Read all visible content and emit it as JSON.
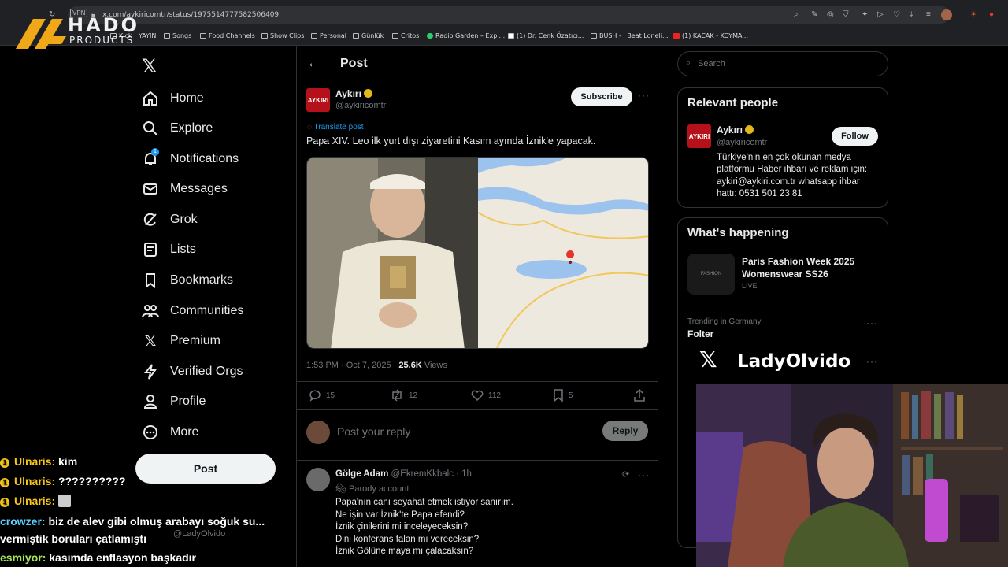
{
  "browser": {
    "url": "x.com/aykiricomtr/status/1975514777582506409",
    "vpn_badge": "VPN",
    "bookmarks": [
      "Kick",
      "YAYIN",
      "Songs",
      "Food Channels",
      "Show Clips",
      "Personal",
      "Günlük",
      "Critos",
      "Radio Garden – Expl...",
      "(1) Dr. Cenk Özatıcı...",
      "BUSH - I Beat Loneli...",
      "(1) KACAK - KOYMA..."
    ]
  },
  "overlay_logo": {
    "hado": "HADO",
    "products": "PRODUCTS"
  },
  "nav": {
    "items": [
      {
        "label": "Home",
        "icon": "home-icon"
      },
      {
        "label": "Explore",
        "icon": "search-icon"
      },
      {
        "label": "Notifications",
        "icon": "bell-icon"
      },
      {
        "label": "Messages",
        "icon": "mail-icon"
      },
      {
        "label": "Grok",
        "icon": "grok-icon"
      },
      {
        "label": "Lists",
        "icon": "list-icon"
      },
      {
        "label": "Bookmarks",
        "icon": "bookmark-icon"
      },
      {
        "label": "Communities",
        "icon": "communities-icon"
      },
      {
        "label": "Premium",
        "icon": "x-icon"
      },
      {
        "label": "Verified Orgs",
        "icon": "lightning-icon"
      },
      {
        "label": "Profile",
        "icon": "person-icon"
      },
      {
        "label": "More",
        "icon": "more-icon"
      }
    ],
    "notification_count": "1",
    "post_label": "Post",
    "profile_handle": "@LadyOlvido"
  },
  "post": {
    "header": "Post",
    "author_name": "Aykırı",
    "author_handle": "@aykiricomtr",
    "avatar_text": "AYKIRI",
    "subscribe_label": "Subscribe",
    "translate_label": "Translate post",
    "text": "Papa XIV. Leo ilk yurt dışı ziyaretini Kasım ayında İznik'e yapacak.",
    "time": "1:53 PM · Oct 7, 2025 ·",
    "views_count": "25.6K",
    "views_label": "Views",
    "replies": "15",
    "reposts": "12",
    "likes": "112",
    "bookmarks": "5",
    "reply_placeholder": "Post your reply",
    "reply_button": "Reply"
  },
  "reply": {
    "name": "Gölge Adam",
    "handle": "@EkremKkbalc · 1h",
    "parody": "Parody account",
    "lines": [
      "Papa'nın canı seyahat etmek istiyor sanırım.",
      "Ne işin var İznik'te Papa efendi?",
      "İznik çinilerini mi inceleyeceksin?",
      "Dini konferans falan mı vereceksin?",
      "İznik Gölüne maya mı çalacaksın?"
    ]
  },
  "sidebar": {
    "search_placeholder": "Search",
    "relevant_title": "Relevant people",
    "rp_name": "Aykırı",
    "rp_handle": "@aykiricomtr",
    "follow_label": "Follow",
    "bio": [
      "Türkiye'nin en çok okunan medya",
      "platformu Haber ihbarı ve reklam için:",
      "aykiri@aykiri.com.tr whatsapp ihbar",
      "hattı: 0531 501 23 81"
    ],
    "happening_title": "What's happening",
    "trend1_title_1": "Paris Fashion Week 2025",
    "trend1_title_2": "Womenswear SS26",
    "trend1_status": "LIVE",
    "trend1_thumb": "FASHION",
    "trend2_context": "Trending in Germany",
    "trend2_name": "Folter"
  },
  "stream": {
    "overlay_name": "LadyOlvido",
    "chat": [
      {
        "user": "Ulnaris:",
        "msg": "kim",
        "badge": "1"
      },
      {
        "user": "Ulnaris:",
        "msg": "??????????",
        "badge": "1"
      },
      {
        "user": "Ulnaris:",
        "msg": "",
        "badge": "1"
      },
      {
        "user": "crowzer:",
        "msg": "biz de alev gibi olmuş arabayı soğuk su...",
        "badge": ""
      },
      {
        "user": "",
        "msg": "vermiştik boruları çatlamıştı",
        "badge": ""
      },
      {
        "user": "esmiyor:",
        "msg": "kasımda enflasyon başkadır",
        "badge": ""
      }
    ]
  },
  "colors": {
    "accent": "#1d9bf0",
    "bg": "#000000",
    "muted": "#71767b",
    "text": "#e7e9ea",
    "brand_red": "#b5111a"
  }
}
